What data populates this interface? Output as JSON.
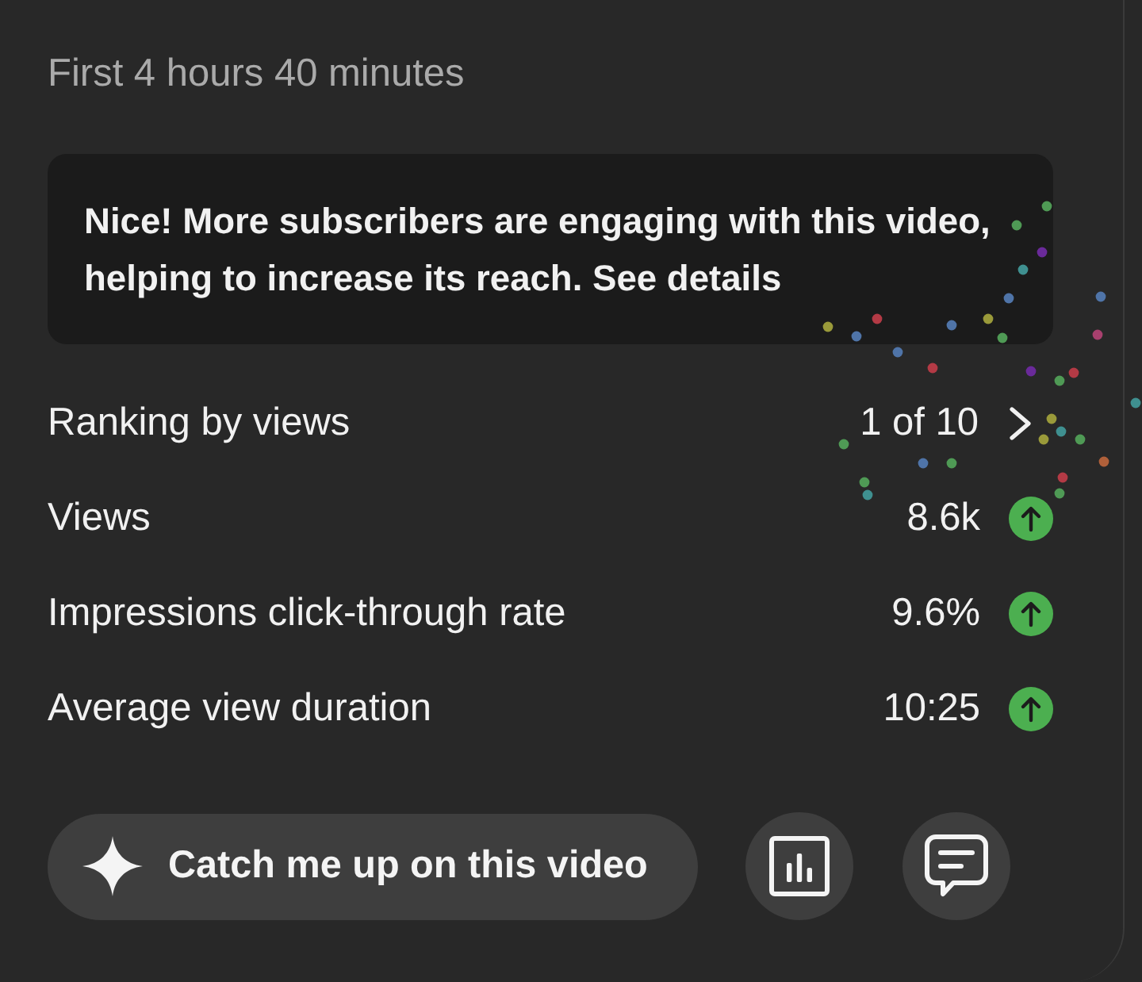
{
  "period": {
    "label": "First 4 hours 40 minutes"
  },
  "insight": {
    "message": "Nice! More subscribers are engaging with this video, helping to increase its reach. See details",
    "confetti": true
  },
  "stats": [
    {
      "kind": "ranking",
      "label": "Ranking by views",
      "value": "1 of 10"
    },
    {
      "kind": "metric",
      "label": "Views",
      "value": "8.6k",
      "rising": true
    },
    {
      "kind": "metric",
      "label": "Impressions click-through rate",
      "value": "9.6%",
      "rising": true
    },
    {
      "kind": "metric",
      "label": "Average view duration",
      "value": "10:25",
      "rising": true
    }
  ],
  "actions": [
    {
      "kind": "ai-summary",
      "label": "Catch me up on this video"
    },
    {
      "kind": "analytics"
    },
    {
      "kind": "comments"
    }
  ]
}
